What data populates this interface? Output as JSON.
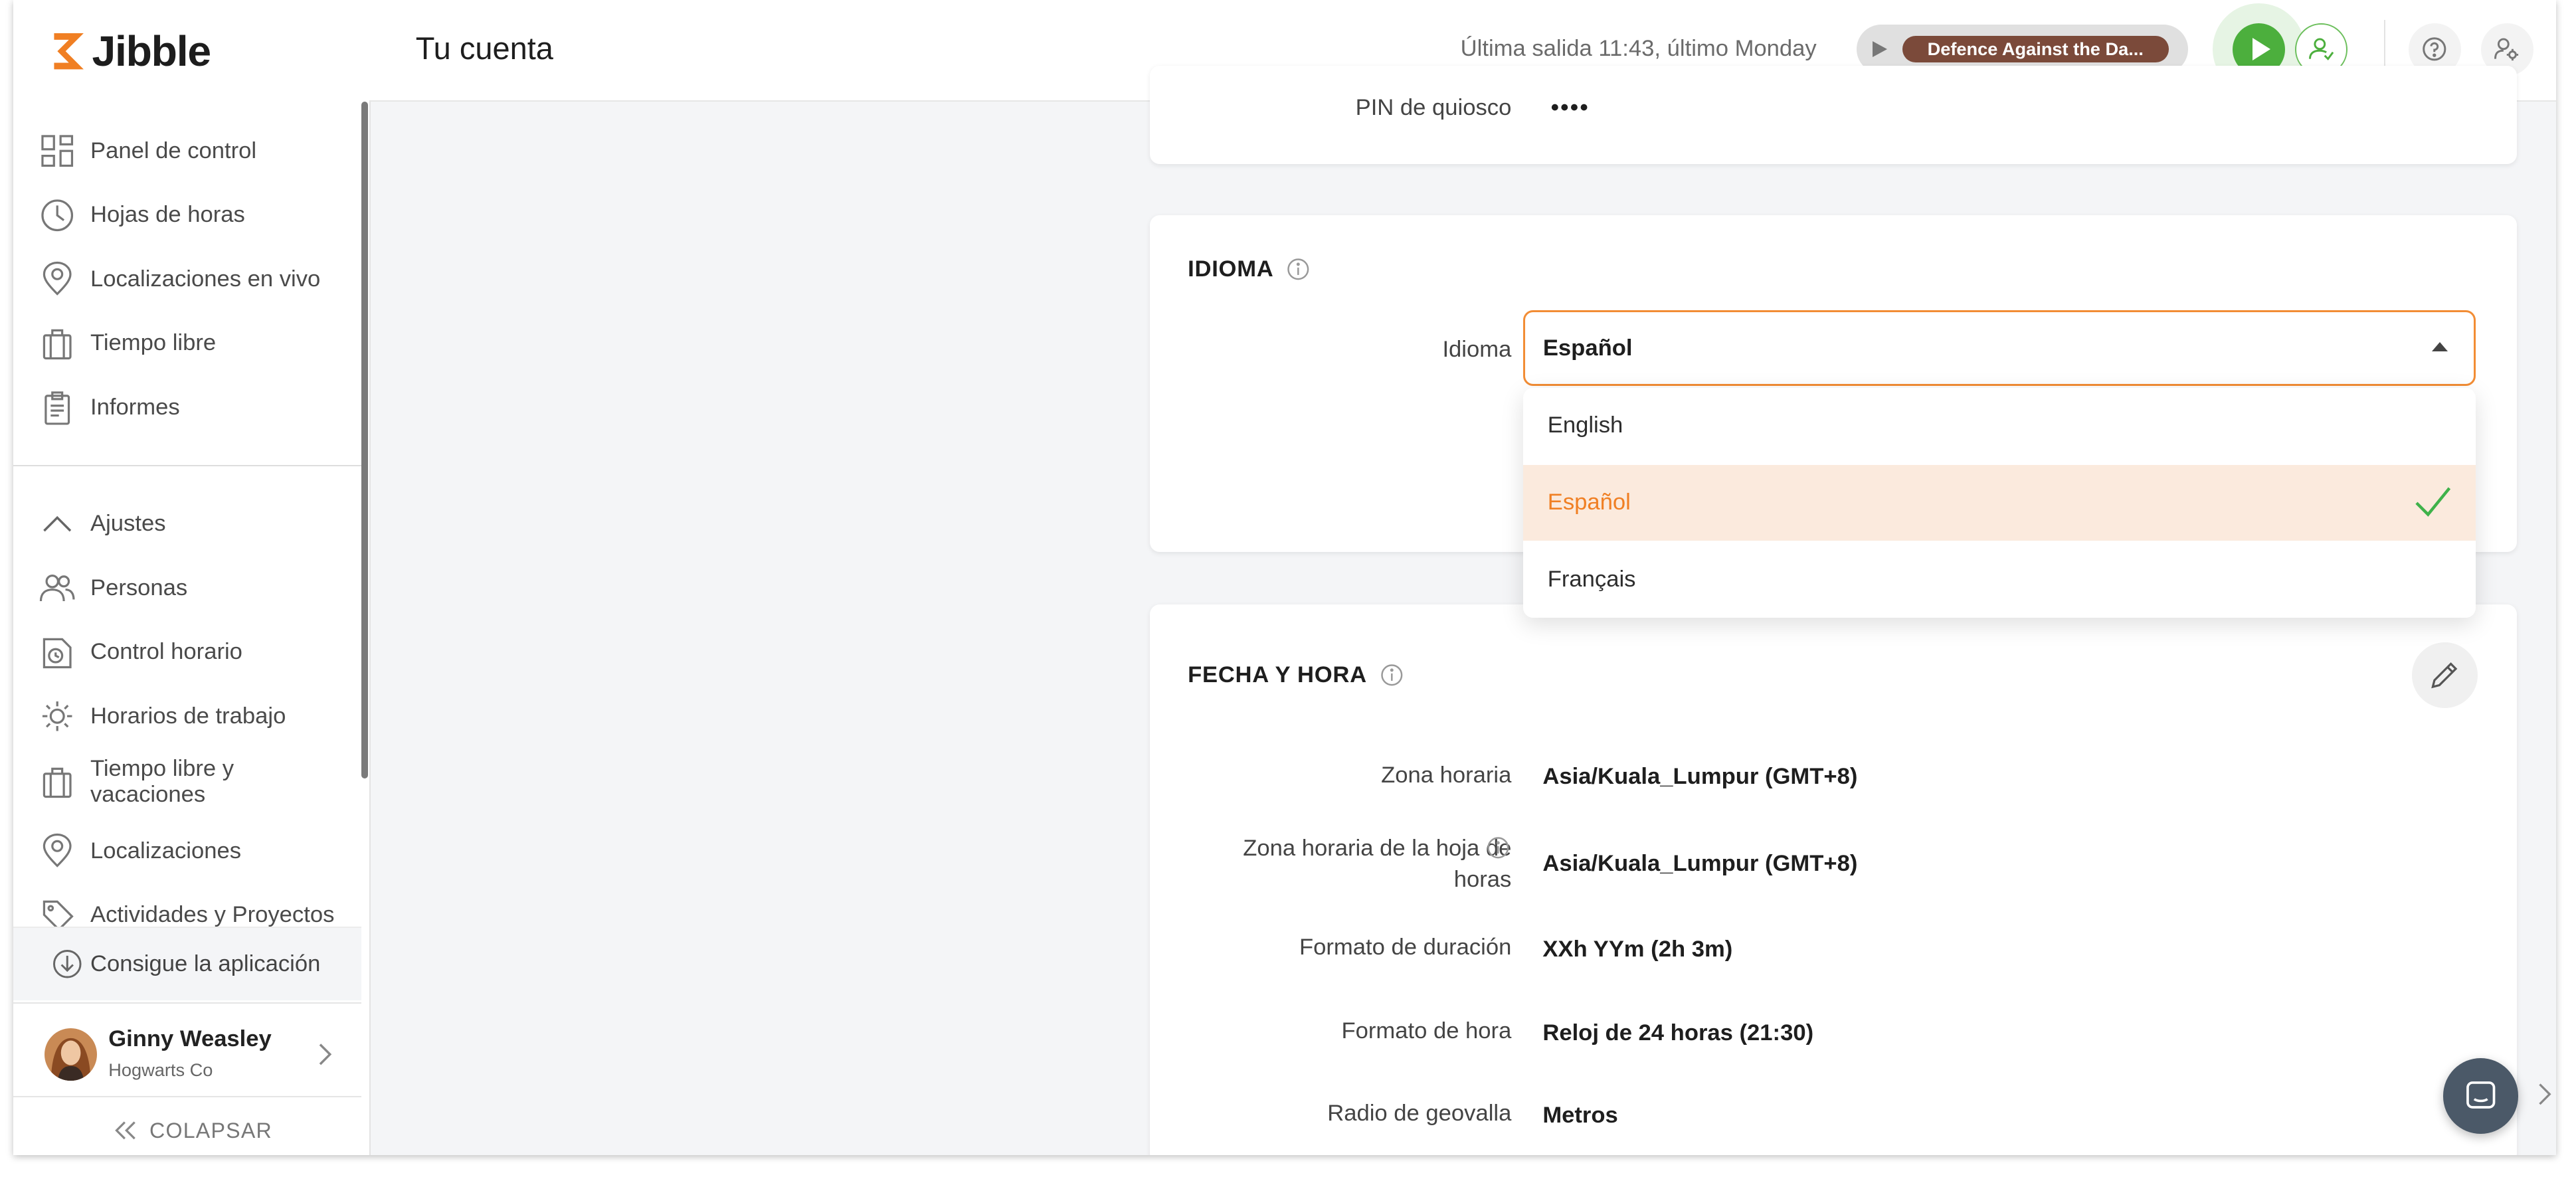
{
  "app": {
    "name": "Jibble",
    "brand_color": "#f07f23"
  },
  "sidebar": {
    "main_items": [
      {
        "label": "Panel de control",
        "icon": "dashboard-icon"
      },
      {
        "label": "Hojas de horas",
        "icon": "clock-icon"
      },
      {
        "label": "Localizaciones en vivo",
        "icon": "map-pin-icon"
      },
      {
        "label": "Tiempo libre",
        "icon": "suitcase-icon"
      },
      {
        "label": "Informes",
        "icon": "clipboard-icon"
      }
    ],
    "settings_header": "Ajustes",
    "settings_items": [
      {
        "label": "Personas",
        "icon": "people-icon"
      },
      {
        "label": "Control horario",
        "icon": "time-tracking-icon"
      },
      {
        "label": "Horarios de trabajo",
        "icon": "schedule-icon"
      },
      {
        "label": "Tiempo libre y vacaciones",
        "icon": "suitcase-icon"
      },
      {
        "label": "Localizaciones",
        "icon": "map-pin-icon"
      },
      {
        "label": "Actividades y Proyectos",
        "icon": "tag-icon"
      }
    ],
    "get_app": "Consigue la aplicación",
    "user": {
      "name": "Ginny Weasley",
      "org": "Hogwarts Co"
    },
    "collapse": "COLAPSAR"
  },
  "header": {
    "title": "Tu cuenta",
    "last_out": "Última salida 11:43, último Monday",
    "activity": "Defence Against the Da..."
  },
  "kiosk": {
    "label": "PIN de quiosco",
    "value": "••••"
  },
  "language": {
    "section_title": "IDIOMA",
    "field_label": "Idioma",
    "selected": "Español",
    "options": [
      "English",
      "Español",
      "Français"
    ],
    "selected_index": 1
  },
  "datetime": {
    "section_title": "FECHA Y HORA",
    "rows": [
      {
        "label": "Zona horaria",
        "value": "Asia/Kuala_Lumpur (GMT+8)"
      },
      {
        "label": "Zona horaria de la hoja de horas",
        "value": "Asia/Kuala_Lumpur (GMT+8)"
      },
      {
        "label": "Formato de duración",
        "value": "XXh YYm (2h 3m)"
      },
      {
        "label": "Formato de hora",
        "value": "Reloj de 24 horas (21:30)"
      },
      {
        "label": "Radio de geovalla",
        "value": "Metros"
      }
    ]
  }
}
